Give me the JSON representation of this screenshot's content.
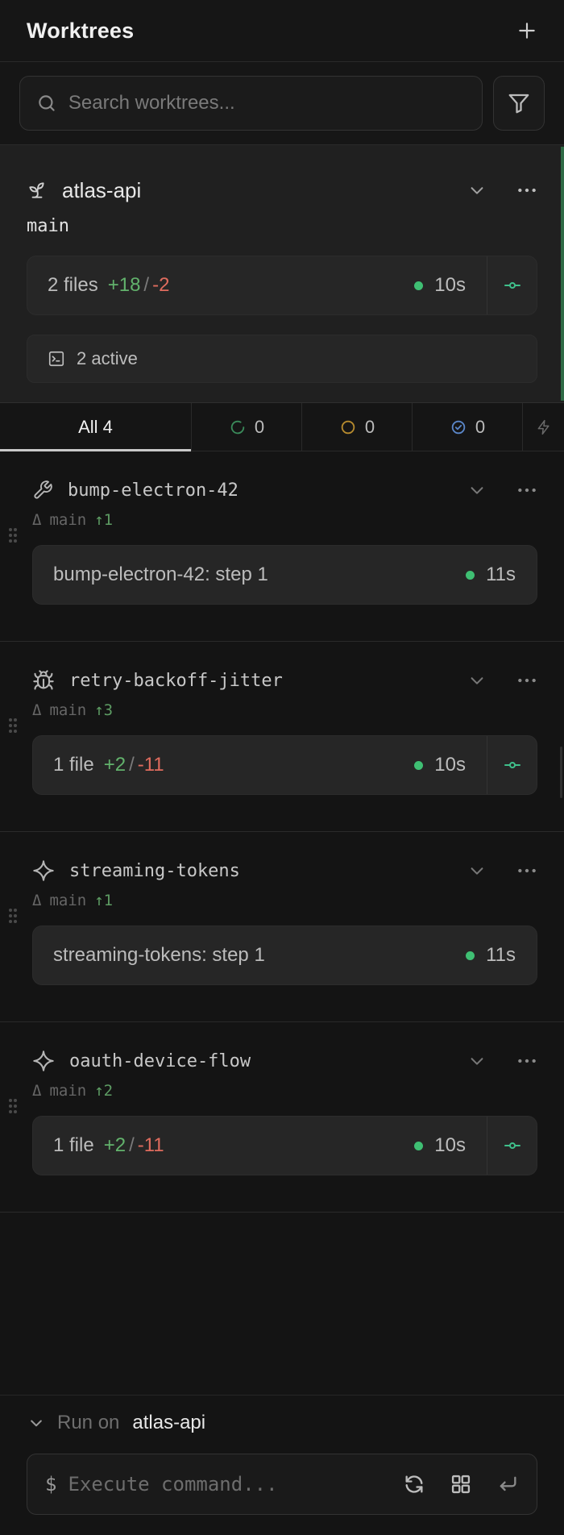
{
  "header": {
    "title": "Worktrees",
    "add_icon": "plus-icon"
  },
  "search": {
    "placeholder": "Search worktrees...",
    "value": "",
    "icons": [
      "search-icon",
      "filter-icon"
    ]
  },
  "current": {
    "name": "atlas-api",
    "icon": "sprout-icon",
    "branch": "main",
    "files": "2 files",
    "added": "+18",
    "separator": "/",
    "removed": "-2",
    "time": "10s",
    "active": "2 active",
    "accent_color": "#2f6b46"
  },
  "tabs": [
    {
      "label": "All 4",
      "icon": ""
    },
    {
      "label": "0",
      "icon": "running-circle-icon",
      "color": "#3a8a5a"
    },
    {
      "label": "0",
      "icon": "pending-circle-icon",
      "color": "#b58a2e"
    },
    {
      "label": "0",
      "icon": "done-check-icon",
      "color": "#5a86c8"
    },
    {
      "label": "",
      "icon": "lightning-icon"
    }
  ],
  "worktrees": [
    {
      "name": "bump-electron-42",
      "icon": "wrench-icon",
      "base": "main",
      "ahead": "1",
      "task": "bump-electron-42: step 1",
      "time": "11s"
    },
    {
      "name": "retry-backoff-jitter",
      "icon": "bug-icon",
      "base": "main",
      "ahead": "3",
      "files": "1 file",
      "added": "+2",
      "separator": "/",
      "removed": "-11",
      "time": "10s"
    },
    {
      "name": "streaming-tokens",
      "icon": "sparkle-icon",
      "base": "main",
      "ahead": "1",
      "task": "streaming-tokens: step 1",
      "time": "11s"
    },
    {
      "name": "oauth-device-flow",
      "icon": "sparkle-icon",
      "base": "main",
      "ahead": "2",
      "files": "1 file",
      "added": "+2",
      "separator": "/",
      "removed": "-11",
      "time": "10s"
    }
  ],
  "bottom": {
    "run_on_label": "Run on",
    "run_on_target": "atlas-api",
    "prompt": "$",
    "command_placeholder": "Execute command...",
    "command_value": ""
  },
  "symbols": {
    "delta": "Δ",
    "arrow_up": "↑"
  }
}
